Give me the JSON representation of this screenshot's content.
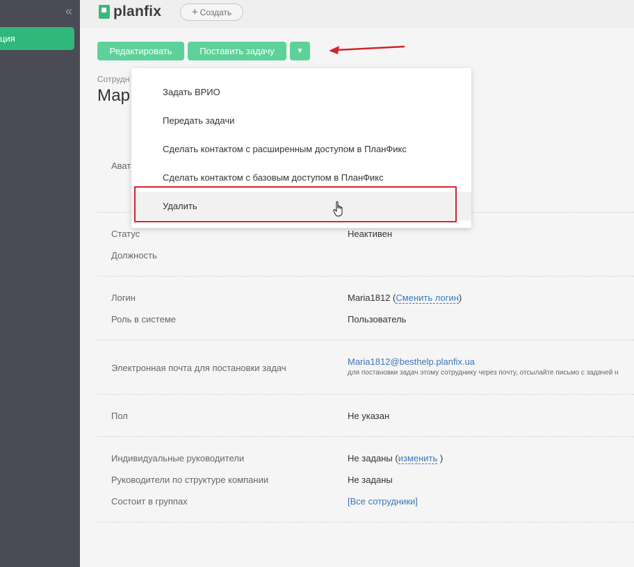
{
  "sidebar": {
    "collapse_icon": "«",
    "active_item_label": "ция"
  },
  "topbar": {
    "logo_text": "planfix",
    "create_button_label": "Создать"
  },
  "toolbar": {
    "edit_label": "Редактировать",
    "assign_task_label": "Поставить задачу",
    "more_icon": "▼"
  },
  "header": {
    "subtitle": "Сотрудн",
    "name": "Мар"
  },
  "rows": {
    "avatar_label": "Авата",
    "status_label": "Статус",
    "status_value": "Неактивен",
    "position_label": "Должность",
    "login_label": "Логин",
    "login_value": "Maria1812",
    "login_open": " (",
    "login_change_link": "Сменить логин",
    "login_close": ")",
    "role_label": "Роль в системе",
    "role_value": "Пользователь",
    "email_label": "Электронная почта для постановки задач",
    "email_value": "Maria1812@besthelp.planfix.ua",
    "email_hint": "для постановки задач этому сотруднику через почту, отсылайте письмо с задачей н",
    "gender_label": "Пол",
    "gender_value": "Не указан",
    "managers_label": "Индивидуальные руководители",
    "managers_value": "Не заданы",
    "managers_open": " (",
    "managers_change_link": "изменить",
    "managers_close": " )",
    "struct_managers_label": "Руководители по структуре компании",
    "struct_managers_value": "Не заданы",
    "groups_label": "Состоит в группах",
    "groups_value": "[Все сотрудники]"
  },
  "dropdown": {
    "items": [
      {
        "label": "Задать ВРИО"
      },
      {
        "label": "Передать задачи"
      },
      {
        "label": "Сделать контактом с расширенным доступом в ПланФикс"
      },
      {
        "label": "Сделать контактом с базовым доступом в ПланФикс"
      },
      {
        "label": "Удалить"
      }
    ]
  },
  "colors": {
    "accent_green": "#5ed19a",
    "sidebar_bg": "#4a4b55",
    "annotation_red": "#d1242c",
    "link_blue": "#3d76b8"
  }
}
